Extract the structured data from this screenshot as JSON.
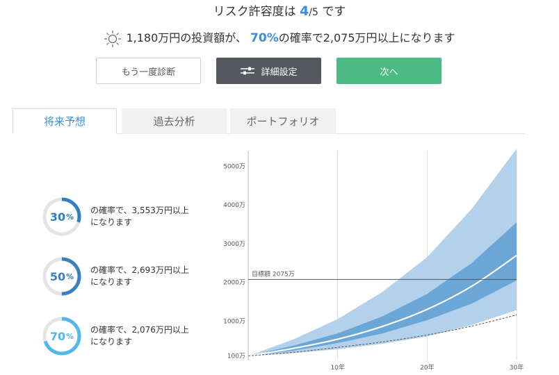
{
  "header": {
    "title_prefix": "リスク許容度は",
    "score": "4",
    "score_sep": "/",
    "score_max": "5",
    "title_suffix": "です"
  },
  "summary": {
    "icon": "sun-icon",
    "amount_text": "1,180万円の投資額が、",
    "pct": "70%",
    "tail": "の確率で2,075万円以上になります"
  },
  "buttons": {
    "retry": "もう一度診断",
    "settings": "詳細設定",
    "settings_icon": "sliders-icon",
    "next": "次へ"
  },
  "tabs": [
    "将来予想",
    "過去分析",
    "ポートフォリオ"
  ],
  "probabilities": [
    {
      "pct": "30",
      "unit": "%",
      "line1": "の確率で、3,553万円以上",
      "line2": "になります",
      "fraction": 0.3,
      "color": "#2f7fc6"
    },
    {
      "pct": "50",
      "unit": "%",
      "line1": "の確率で、2,693万円以上",
      "line2": "になります",
      "fraction": 0.5,
      "color": "#3a7fbf"
    },
    {
      "pct": "70",
      "unit": "%",
      "line1": "の確率で、2,076万円以上",
      "line2": "になります",
      "fraction": 0.7,
      "color": "#4fb8ec"
    }
  ],
  "colors": {
    "accent": "#3a8ee0",
    "next_green": "#4dba86",
    "settings_gray": "#55595d",
    "outer_band": "#b3d1ea",
    "inner_band": "#6aa6d6",
    "ring_track": "#e4e4e4"
  },
  "chart_data": {
    "type": "area",
    "y_unit": "万",
    "x_unit": "年",
    "xlim": [
      0,
      30
    ],
    "ylim": [
      0,
      5400
    ],
    "y_ticks": [
      {
        "value": 100,
        "label": "100万"
      },
      {
        "value": 1000,
        "label": "1000万"
      },
      {
        "value": 2000,
        "label": "2000万"
      },
      {
        "value": 3000,
        "label": "3000万"
      },
      {
        "value": 4000,
        "label": "4000万"
      },
      {
        "value": 5000,
        "label": "5000万"
      }
    ],
    "x_ticks": [
      {
        "value": 10,
        "label": "10年"
      },
      {
        "value": 20,
        "label": "20年"
      },
      {
        "value": 30,
        "label": "30年"
      }
    ],
    "target": {
      "value": 2075,
      "label": "目標額 2075万"
    },
    "x": [
      0,
      5,
      10,
      15,
      20,
      25,
      30
    ],
    "outer_upper": [
      100,
      520,
      1050,
      1750,
      2650,
      3900,
      5450
    ],
    "outer_lower": [
      100,
      170,
      270,
      410,
      600,
      900,
      1280
    ],
    "inner_upper": [
      100,
      360,
      680,
      1120,
      1700,
      2500,
      3550
    ],
    "inner_lower": [
      100,
      230,
      430,
      680,
      1020,
      1450,
      2050
    ],
    "median": [
      100,
      290,
      530,
      860,
      1300,
      1900,
      2693
    ],
    "baseline": [
      100,
      190,
      320,
      460,
      640,
      870,
      1160
    ]
  }
}
